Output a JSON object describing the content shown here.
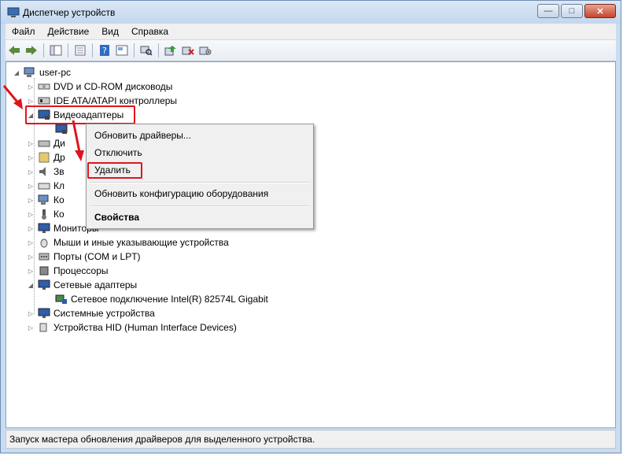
{
  "window": {
    "title": "Диспетчер устройств",
    "min": "—",
    "max": "□",
    "close": "✕"
  },
  "menu": [
    "Файл",
    "Действие",
    "Вид",
    "Справка"
  ],
  "tree": {
    "root": "user-pc",
    "items": [
      {
        "label": "DVD и CD-ROM дисководы",
        "icon": "disc-drive-icon",
        "expanded": false
      },
      {
        "label": "IDE ATA/ATAPI контроллеры",
        "icon": "ide-controller-icon",
        "expanded": false
      },
      {
        "label": "Видеоадаптеры",
        "icon": "display-adapter-icon",
        "expanded": true
      },
      {
        "label": "Ди",
        "icon": "disk-drive-icon",
        "expanded": false
      },
      {
        "label": "Др",
        "icon": "other-devices-icon",
        "expanded": false
      },
      {
        "label": "Зв",
        "icon": "sound-icon",
        "expanded": false
      },
      {
        "label": "Кл",
        "icon": "keyboard-icon",
        "expanded": false
      },
      {
        "label": "Ко",
        "icon": "computer-icon",
        "expanded": false
      },
      {
        "label": "Ко",
        "icon": "usb-controller-icon",
        "expanded": false
      },
      {
        "label": "Мониторы",
        "icon": "monitor-icon",
        "expanded": false
      },
      {
        "label": "Мыши и иные указывающие устройства",
        "icon": "mouse-icon",
        "expanded": false
      },
      {
        "label": "Порты (COM и LPT)",
        "icon": "port-icon",
        "expanded": false
      },
      {
        "label": "Процессоры",
        "icon": "processor-icon",
        "expanded": false
      },
      {
        "label": "Сетевые адаптеры",
        "icon": "network-adapter-icon",
        "expanded": true
      },
      {
        "label": "Сетевое подключение Intel(R) 82574L Gigabit",
        "icon": "network-card-icon",
        "child": true
      },
      {
        "label": "Системные устройства",
        "icon": "system-devices-icon",
        "expanded": false
      },
      {
        "label": "Устройства HID (Human Interface Devices)",
        "icon": "hid-icon",
        "expanded": false
      }
    ]
  },
  "context_menu": {
    "update_drivers": "Обновить драйверы...",
    "disable": "Отключить",
    "uninstall": "Удалить",
    "scan_hardware": "Обновить конфигурацию оборудования",
    "properties": "Свойства"
  },
  "status": "Запуск мастера обновления драйверов для выделенного устройства.",
  "colors": {
    "highlight": "#e0141c",
    "titlebar": "#c2d6ec"
  }
}
